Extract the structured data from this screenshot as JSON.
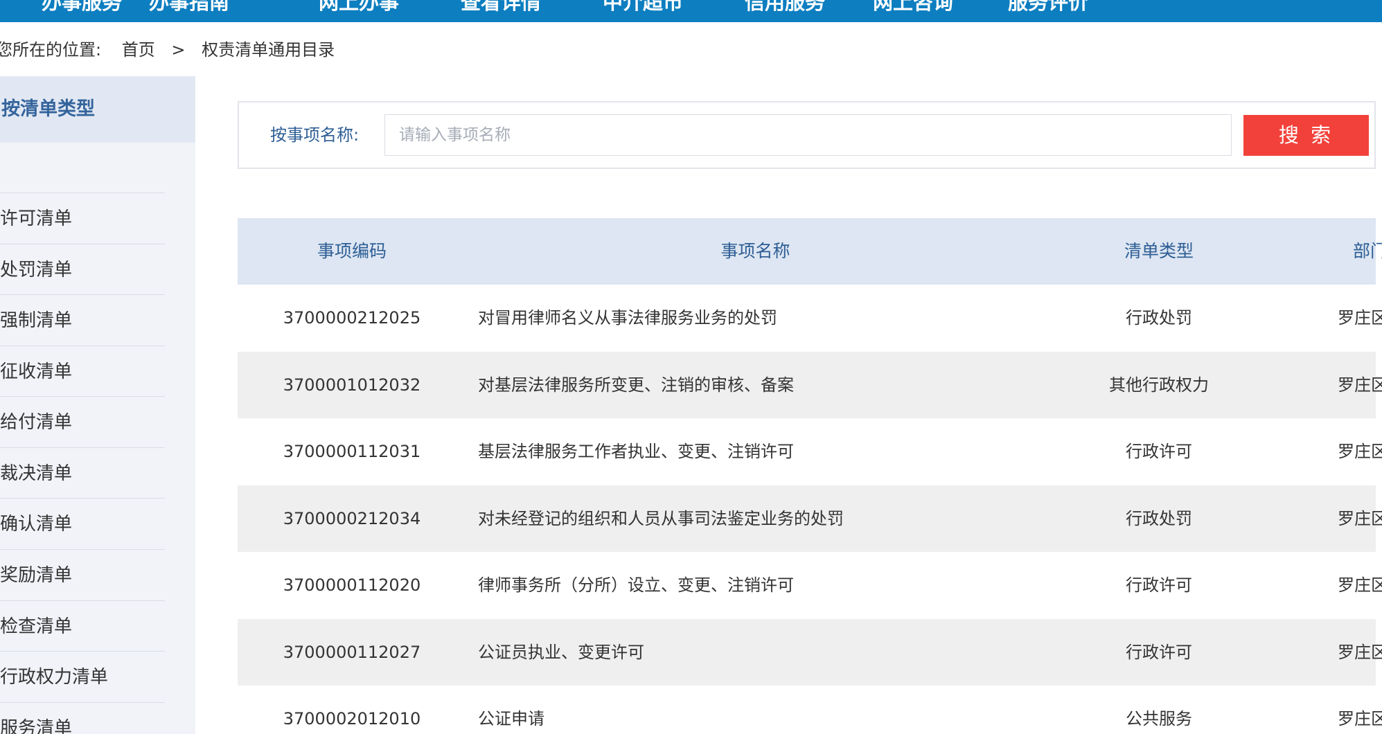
{
  "nav": {
    "items": [
      {
        "label": "办事服务"
      },
      {
        "label": "办事指南"
      },
      {
        "label": "网上办事"
      },
      {
        "label": "查看详情"
      },
      {
        "label": "中介超市"
      },
      {
        "label": "信用服务"
      },
      {
        "label": "网上咨询"
      },
      {
        "label": "服务评价"
      }
    ]
  },
  "breadcrumb": {
    "label": "您所在的位置:",
    "home": "首页",
    "separator": ">",
    "current": "权责清单通用目录"
  },
  "sidebar": {
    "title": "按清单类型",
    "items": [
      {
        "label": "许可清单"
      },
      {
        "label": "处罚清单"
      },
      {
        "label": "强制清单"
      },
      {
        "label": "征收清单"
      },
      {
        "label": "给付清单"
      },
      {
        "label": "裁决清单"
      },
      {
        "label": "确认清单"
      },
      {
        "label": "奖励清单"
      },
      {
        "label": "检查清单"
      },
      {
        "label": "行政权力清单"
      },
      {
        "label": "服务清单"
      }
    ]
  },
  "search": {
    "label": "按事项名称:",
    "placeholder": "请输入事项名称",
    "value": "",
    "button_label": "搜 索"
  },
  "table": {
    "headers": {
      "code": "事项编码",
      "name": "事项名称",
      "type": "清单类型",
      "dept": "部门名称"
    },
    "rows": [
      {
        "code": "3700000212025",
        "name": "对冒用律师名义从事法律服务业务的处罚",
        "type": "行政处罚",
        "dept": "罗庄区司法局"
      },
      {
        "code": "3700001012032",
        "name": "对基层法律服务所变更、注销的审核、备案",
        "type": "其他行政权力",
        "dept": "罗庄区司法局"
      },
      {
        "code": "3700000112031",
        "name": "基层法律服务工作者执业、变更、注销许可",
        "type": "行政许可",
        "dept": "罗庄区司法局"
      },
      {
        "code": "3700000212034",
        "name": "对未经登记的组织和人员从事司法鉴定业务的处罚",
        "type": "行政处罚",
        "dept": "罗庄区司法局"
      },
      {
        "code": "3700000112020",
        "name": "律师事务所（分所）设立、变更、注销许可",
        "type": "行政许可",
        "dept": "罗庄区司法局"
      },
      {
        "code": "3700000112027",
        "name": "公证员执业、变更许可",
        "type": "行政许可",
        "dept": "罗庄区司法局"
      },
      {
        "code": "3700002012010",
        "name": "公证申请",
        "type": "公共服务",
        "dept": "罗庄区司法局"
      }
    ]
  },
  "colors": {
    "nav_bg": "#0d7ec0",
    "accent_text": "#2e5e95",
    "search_button": "#f2413a",
    "table_header_bg": "#dde6f2",
    "row_alt_bg": "#efefef",
    "sidebar_bg": "#f1f3f8"
  }
}
